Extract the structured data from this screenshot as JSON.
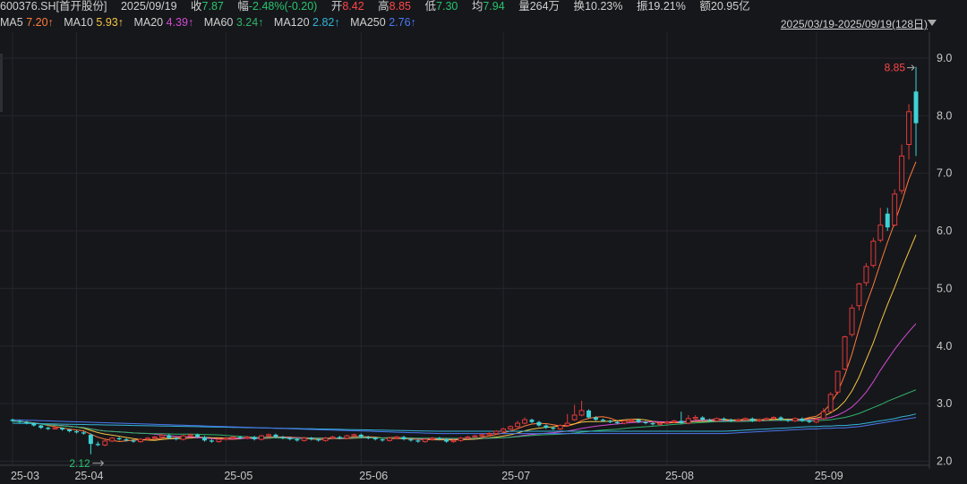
{
  "header": {
    "symbol": "600376.SH[首开股份]",
    "date": "2025/09/19",
    "close_label": "收",
    "close": "7.87",
    "change_label": "幅",
    "change": "-2.48%(-0.20)",
    "open_label": "开",
    "open": "8.42",
    "high_label": "高",
    "high": "8.85",
    "low_label": "低",
    "low": "7.30",
    "avg_label": "均",
    "avg": "7.94",
    "volume_label": "量",
    "volume": "264万",
    "turnover_label": "换",
    "turnover": "10.23%",
    "amplitude_label": "振",
    "amplitude": "19.21%",
    "amount_label": "额",
    "amount": "20.95亿"
  },
  "ma_legend": [
    {
      "name": "MA5",
      "value": "7.20↑",
      "color": "#ff7b3a"
    },
    {
      "name": "MA10",
      "value": "5.93↑",
      "color": "#f5c542"
    },
    {
      "name": "MA20",
      "value": "4.39↑",
      "color": "#d24bd2"
    },
    {
      "name": "MA60",
      "value": "3.24↑",
      "color": "#2fb36a"
    },
    {
      "name": "MA120",
      "value": "2.82↑",
      "color": "#32b5d8"
    },
    {
      "name": "MA250",
      "value": "2.76↑",
      "color": "#4a78f0"
    }
  ],
  "range_label": "2025/03/19-2025/09/19(128日)",
  "chart_data": {
    "type": "candlestick",
    "y_ticks": [
      "9.0",
      "8.0",
      "7.0",
      "6.0",
      "5.0",
      "4.0",
      "3.0",
      "2.0"
    ],
    "ylim": [
      1.93,
      9.45
    ],
    "x_ticks": [
      {
        "label": "25-03",
        "index": 0
      },
      {
        "label": "25-04",
        "index": 9
      },
      {
        "label": "25-05",
        "index": 30
      },
      {
        "label": "25-06",
        "index": 49
      },
      {
        "label": "25-07",
        "index": 69
      },
      {
        "label": "25-08",
        "index": 92
      },
      {
        "label": "25-09",
        "index": 113
      }
    ],
    "annotations": [
      {
        "text": "8.85",
        "index": 127,
        "value": 8.85,
        "color": "#ff4545"
      },
      {
        "text": "2.12",
        "index": 11,
        "value": 2.12,
        "color": "#27c46e"
      }
    ],
    "up_color": "#e03a3a",
    "down_color": "#3ed2d6",
    "close": [
      2.7,
      2.68,
      2.66,
      2.62,
      2.58,
      2.56,
      2.58,
      2.55,
      2.52,
      2.5,
      2.48,
      2.3,
      2.28,
      2.35,
      2.4,
      2.38,
      2.36,
      2.34,
      2.38,
      2.4,
      2.42,
      2.45,
      2.4,
      2.38,
      2.44,
      2.46,
      2.42,
      2.36,
      2.34,
      2.38,
      2.4,
      2.42,
      2.4,
      2.42,
      2.38,
      2.44,
      2.46,
      2.42,
      2.4,
      2.38,
      2.36,
      2.4,
      2.38,
      2.36,
      2.4,
      2.42,
      2.4,
      2.44,
      2.46,
      2.42,
      2.4,
      2.38,
      2.36,
      2.4,
      2.42,
      2.38,
      2.36,
      2.34,
      2.38,
      2.4,
      2.38,
      2.34,
      2.36,
      2.4,
      2.42,
      2.44,
      2.46,
      2.48,
      2.52,
      2.56,
      2.6,
      2.66,
      2.72,
      2.68,
      2.62,
      2.58,
      2.56,
      2.62,
      2.66,
      2.8,
      2.88,
      2.76,
      2.72,
      2.7,
      2.68,
      2.66,
      2.7,
      2.72,
      2.68,
      2.66,
      2.64,
      2.66,
      2.68,
      2.7,
      2.66,
      2.74,
      2.76,
      2.72,
      2.7,
      2.74,
      2.72,
      2.7,
      2.72,
      2.74,
      2.7,
      2.72,
      2.74,
      2.76,
      2.72,
      2.7,
      2.74,
      2.7,
      2.68,
      2.72,
      2.86,
      3.16,
      3.56,
      4.16,
      4.66,
      5.08,
      5.38,
      5.82,
      6.1,
      6.06,
      6.64,
      7.3,
      8.07,
      7.87
    ],
    "open": [
      2.72,
      2.7,
      2.68,
      2.66,
      2.62,
      2.58,
      2.56,
      2.58,
      2.55,
      2.52,
      2.5,
      2.46,
      2.3,
      2.28,
      2.35,
      2.4,
      2.38,
      2.36,
      2.34,
      2.38,
      2.4,
      2.42,
      2.45,
      2.4,
      2.38,
      2.44,
      2.46,
      2.42,
      2.36,
      2.34,
      2.38,
      2.4,
      2.42,
      2.4,
      2.42,
      2.38,
      2.44,
      2.46,
      2.42,
      2.4,
      2.38,
      2.36,
      2.4,
      2.38,
      2.36,
      2.4,
      2.42,
      2.4,
      2.44,
      2.46,
      2.42,
      2.4,
      2.38,
      2.36,
      2.4,
      2.42,
      2.38,
      2.36,
      2.34,
      2.38,
      2.4,
      2.38,
      2.34,
      2.36,
      2.4,
      2.42,
      2.44,
      2.46,
      2.48,
      2.52,
      2.56,
      2.6,
      2.66,
      2.72,
      2.68,
      2.62,
      2.58,
      2.56,
      2.62,
      2.72,
      2.8,
      2.88,
      2.76,
      2.72,
      2.7,
      2.68,
      2.66,
      2.7,
      2.72,
      2.68,
      2.66,
      2.64,
      2.66,
      2.68,
      2.7,
      2.66,
      2.74,
      2.76,
      2.72,
      2.7,
      2.74,
      2.72,
      2.7,
      2.72,
      2.74,
      2.7,
      2.72,
      2.74,
      2.76,
      2.72,
      2.7,
      2.74,
      2.7,
      2.68,
      2.74,
      2.86,
      3.2,
      3.6,
      4.2,
      4.7,
      5.1,
      5.4,
      5.84,
      6.3,
      6.1,
      6.7,
      7.5,
      8.42
    ],
    "high": [
      2.74,
      2.72,
      2.7,
      2.67,
      2.63,
      2.6,
      2.6,
      2.59,
      2.56,
      2.54,
      2.52,
      2.48,
      2.34,
      2.38,
      2.42,
      2.42,
      2.4,
      2.38,
      2.4,
      2.42,
      2.44,
      2.48,
      2.47,
      2.42,
      2.46,
      2.48,
      2.48,
      2.44,
      2.38,
      2.4,
      2.42,
      2.44,
      2.44,
      2.44,
      2.44,
      2.46,
      2.48,
      2.48,
      2.44,
      2.42,
      2.4,
      2.42,
      2.42,
      2.4,
      2.42,
      2.44,
      2.44,
      2.46,
      2.48,
      2.48,
      2.44,
      2.42,
      2.4,
      2.42,
      2.44,
      2.44,
      2.4,
      2.38,
      2.4,
      2.42,
      2.42,
      2.4,
      2.38,
      2.42,
      2.44,
      2.46,
      2.48,
      2.5,
      2.54,
      2.58,
      2.62,
      2.7,
      2.76,
      2.74,
      2.7,
      2.64,
      2.6,
      2.64,
      2.82,
      2.98,
      3.05,
      2.9,
      2.78,
      2.74,
      2.72,
      2.7,
      2.72,
      2.74,
      2.74,
      2.7,
      2.68,
      2.68,
      2.7,
      2.72,
      2.86,
      2.8,
      2.8,
      2.78,
      2.74,
      2.76,
      2.76,
      2.74,
      2.74,
      2.76,
      2.76,
      2.74,
      2.76,
      2.78,
      2.78,
      2.74,
      2.76,
      2.76,
      2.72,
      2.76,
      2.92,
      3.2,
      3.52,
      4.18,
      4.72,
      5.1,
      5.44,
      5.88,
      6.4,
      6.4,
      6.72,
      7.5,
      8.2,
      8.85
    ],
    "low": [
      2.68,
      2.66,
      2.64,
      2.6,
      2.56,
      2.54,
      2.55,
      2.53,
      2.5,
      2.48,
      2.46,
      2.12,
      2.26,
      2.26,
      2.33,
      2.36,
      2.34,
      2.32,
      2.32,
      2.36,
      2.38,
      2.4,
      2.38,
      2.36,
      2.36,
      2.42,
      2.4,
      2.34,
      2.32,
      2.32,
      2.36,
      2.38,
      2.38,
      2.38,
      2.36,
      2.36,
      2.42,
      2.4,
      2.38,
      2.36,
      2.34,
      2.34,
      2.36,
      2.34,
      2.34,
      2.38,
      2.38,
      2.38,
      2.42,
      2.4,
      2.38,
      2.36,
      2.34,
      2.34,
      2.38,
      2.36,
      2.34,
      2.32,
      2.32,
      2.36,
      2.36,
      2.32,
      2.32,
      2.34,
      2.38,
      2.4,
      2.42,
      2.44,
      2.46,
      2.5,
      2.54,
      2.58,
      2.64,
      2.66,
      2.6,
      2.56,
      2.54,
      2.54,
      2.6,
      2.7,
      2.78,
      2.74,
      2.7,
      2.68,
      2.66,
      2.64,
      2.64,
      2.68,
      2.66,
      2.64,
      2.62,
      2.62,
      2.64,
      2.66,
      2.64,
      2.64,
      2.72,
      2.7,
      2.68,
      2.68,
      2.7,
      2.68,
      2.68,
      2.7,
      2.68,
      2.68,
      2.7,
      2.72,
      2.7,
      2.68,
      2.68,
      2.68,
      2.66,
      2.66,
      2.72,
      2.86,
      3.16,
      3.58,
      4.16,
      4.62,
      5.04,
      5.36,
      5.8,
      6.0,
      6.08,
      6.64,
      7.24,
      7.3
    ]
  },
  "ma_series": {
    "ma5_last": [
      2.76,
      2.78,
      2.86,
      3.0,
      3.2,
      3.5,
      3.86,
      4.3,
      4.72,
      5.06,
      5.44,
      5.8,
      6.14,
      6.5,
      6.9,
      7.2
    ],
    "ma10_last": [
      2.74,
      2.75,
      2.78,
      2.84,
      2.92,
      3.04,
      3.22,
      3.46,
      3.76,
      4.06,
      4.4,
      4.72,
      5.02,
      5.34,
      5.64,
      5.93
    ],
    "ma20_last": [
      2.72,
      2.73,
      2.74,
      2.76,
      2.8,
      2.86,
      2.94,
      3.06,
      3.2,
      3.38,
      3.58,
      3.76,
      3.94,
      4.1,
      4.25,
      4.39
    ],
    "ma60_last": [
      2.7,
      2.7,
      2.71,
      2.72,
      2.74,
      2.76,
      2.79,
      2.83,
      2.88,
      2.93,
      2.98,
      3.04,
      3.09,
      3.14,
      3.19,
      3.24
    ],
    "ma120_last": [
      2.6,
      2.6,
      2.61,
      2.61,
      2.62,
      2.62,
      2.63,
      2.64,
      2.66,
      2.68,
      2.7,
      2.72,
      2.74,
      2.77,
      2.79,
      2.82
    ],
    "ma250_last": [
      2.56,
      2.56,
      2.57,
      2.57,
      2.58,
      2.58,
      2.59,
      2.6,
      2.62,
      2.64,
      2.66,
      2.68,
      2.7,
      2.72,
      2.74,
      2.76
    ]
  }
}
